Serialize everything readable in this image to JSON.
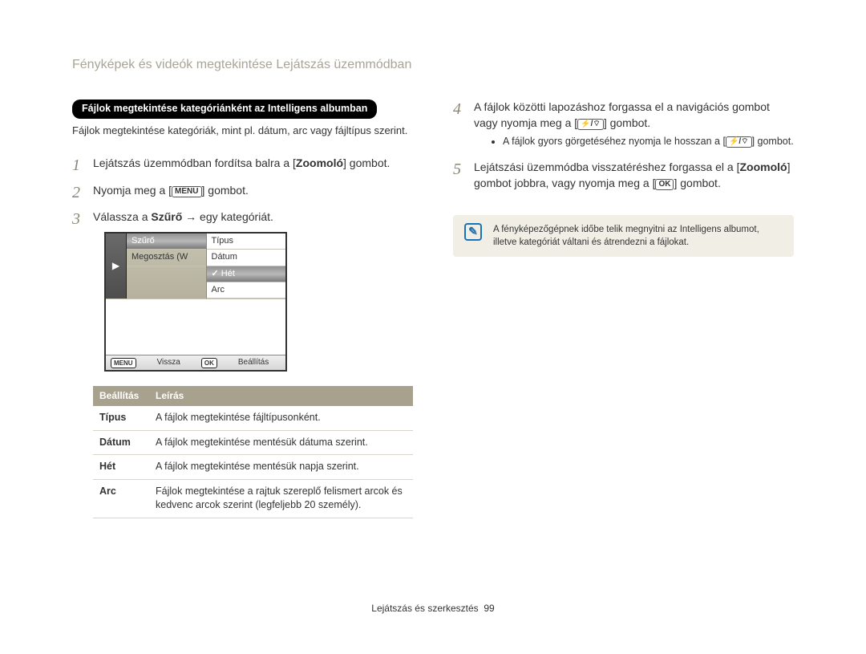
{
  "page_title": "Fényképek és videók megtekintése Lejátszás üzemmódban",
  "left": {
    "heading_pill": "Fájlok megtekintése kategóriánként az Intelligens albumban",
    "intro": "Fájlok megtekintése kategóriák, mint pl. dátum, arc vagy fájltípus szerint.",
    "step1_a": "Lejátszás üzemmódban fordítsa balra a [",
    "step1_b": "Zoomoló",
    "step1_c": "] gombot.",
    "step2_a": "Nyomja meg a [",
    "step2_key": "MENU",
    "step2_b": "] gombot.",
    "step3_a": "Válassza a ",
    "step3_b": "Szűrő",
    "step3_c": " → egy kategóriát.",
    "ui": {
      "left_col": [
        "Szűrő",
        "Megosztás (W"
      ],
      "right_col": [
        "Típus",
        "Dátum",
        "Hét",
        "Arc"
      ],
      "selected": "Hét",
      "back_key": "MENU",
      "back": "Vissza",
      "ok_key": "OK",
      "ok": "Beállítás"
    },
    "table": {
      "head1": "Beállítás",
      "head2": "Leírás",
      "rows": [
        {
          "k": "Típus",
          "v": "A fájlok megtekintése fájltípusonként."
        },
        {
          "k": "Dátum",
          "v": "A fájlok megtekintése mentésük dátuma szerint."
        },
        {
          "k": "Hét",
          "v": "A fájlok megtekintése mentésük napja szerint."
        },
        {
          "k": "Arc",
          "v": "Fájlok megtekintése a rajtuk szereplő felismert arcok és kedvenc arcok szerint (legfeljebb 20 személy)."
        }
      ]
    }
  },
  "right": {
    "step4_a": "A fájlok közötti lapozáshoz forgassa el a navigációs gombot vagy nyomja meg a [",
    "step4_b": "] gombot.",
    "step4_bullet_a": "A fájlok gyors görgetéséhez nyomja le hosszan a [",
    "step4_bullet_b": "] gombot.",
    "step5_a": "Lejátszási üzemmódba visszatéréshez forgassa el a [",
    "step5_b": "Zoomoló",
    "step5_c": "] gombot jobbra, vagy nyomja meg a [",
    "step5_key": "OK",
    "step5_d": "] gombot.",
    "note": "A fényképezőgépnek időbe telik megnyitni az Intelligens albumot, illetve kategóriát váltani és átrendezni a fájlokat."
  },
  "footer_a": "Lejátszás és szerkesztés",
  "footer_b": "99"
}
